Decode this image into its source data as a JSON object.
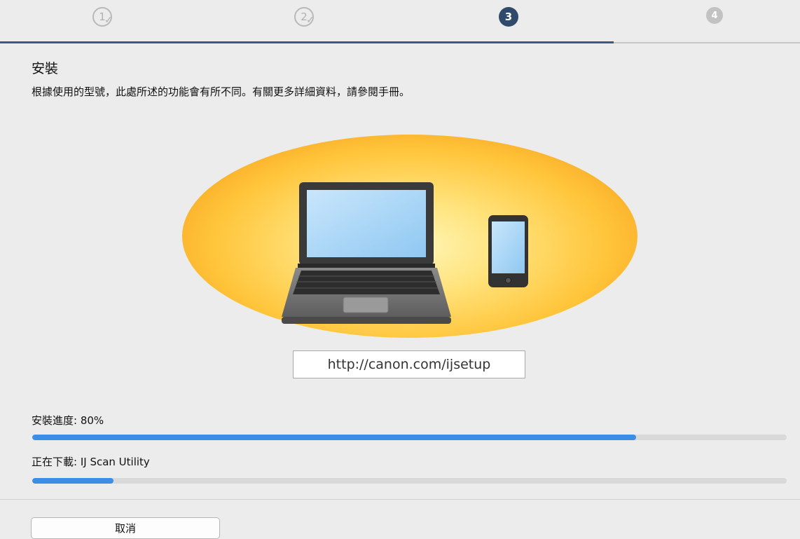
{
  "stepper": {
    "steps": [
      {
        "number": "1",
        "state": "done"
      },
      {
        "number": "2",
        "state": "done"
      },
      {
        "number": "3",
        "state": "current"
      },
      {
        "number": "4",
        "state": "todo"
      }
    ],
    "accent_color": "#2f4a6b"
  },
  "main": {
    "title": "安裝",
    "description": "根據使用的型號，此處所述的功能會有所不同。有關更多詳細資料，請參閱手冊。",
    "illustration_icons": [
      "laptop-icon",
      "smartphone-icon"
    ],
    "url": "http://canon.com/ijsetup"
  },
  "progress": {
    "install_label": "安裝進度: 80%",
    "install_fraction": 0.8,
    "download_label": "正在下載: IJ Scan Utility",
    "download_fraction": 0.108,
    "bar_color": "#3a8ee6"
  },
  "footer": {
    "cancel_label": "取消"
  }
}
